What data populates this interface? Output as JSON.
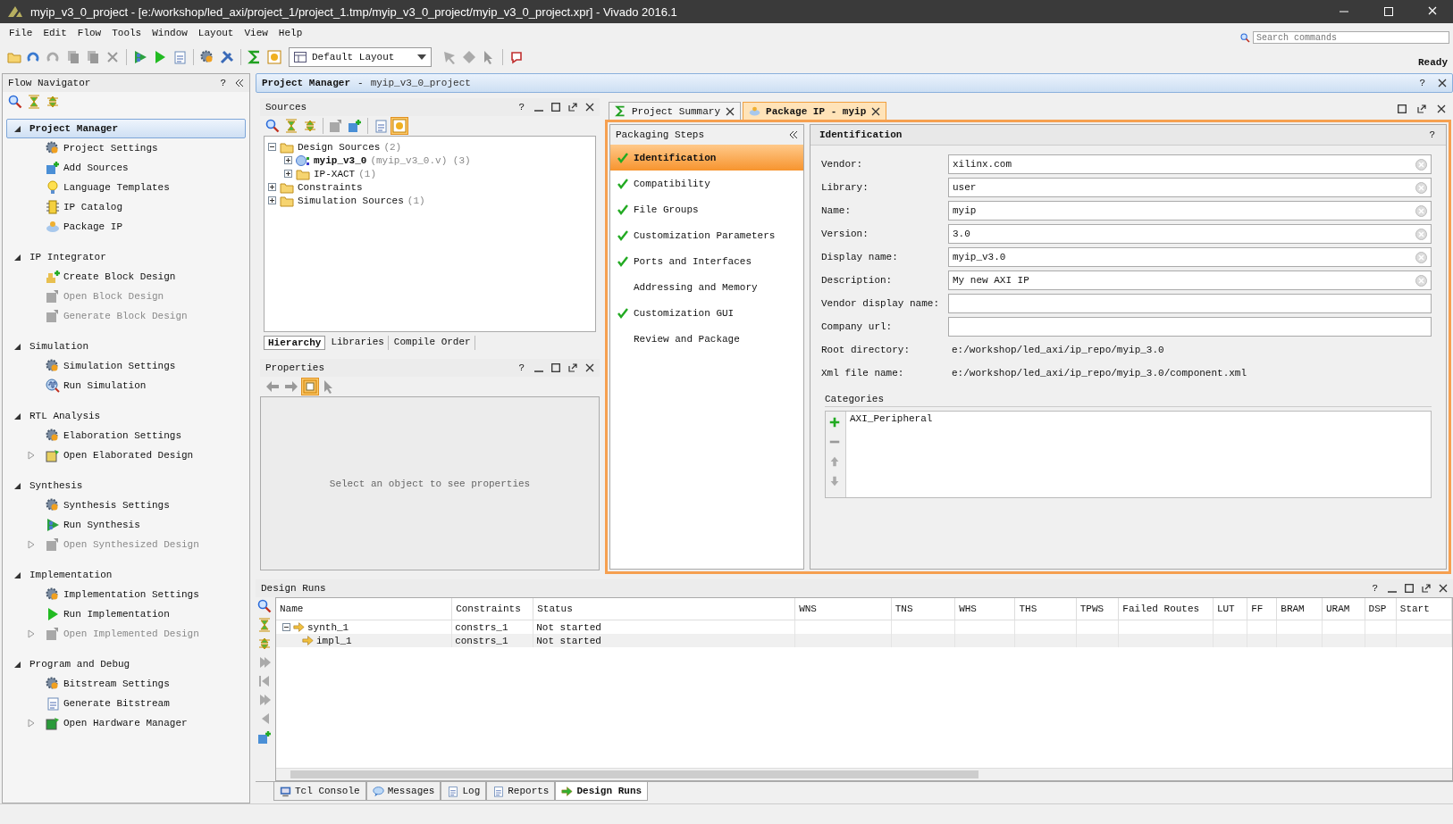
{
  "window": {
    "title": "myip_v3_0_project - [e:/workshop/led_axi/project_1/project_1.tmp/myip_v3_0_project/myip_v3_0_project.xpr] - Vivado 2016.1"
  },
  "menu": [
    "File",
    "Edit",
    "Flow",
    "Tools",
    "Window",
    "Layout",
    "View",
    "Help"
  ],
  "toolbar": {
    "layout": "Default Layout"
  },
  "search": {
    "placeholder": "Search commands"
  },
  "status": "Ready",
  "flow_navigator": {
    "title": "Flow Navigator",
    "help": "?",
    "sections": [
      {
        "label": "Project Manager",
        "selected": true,
        "items": [
          {
            "label": "Project Settings",
            "disabled": false,
            "expandable": false
          },
          {
            "label": "Add Sources",
            "disabled": false,
            "expandable": false
          },
          {
            "label": "Language Templates",
            "disabled": false,
            "expandable": false
          },
          {
            "label": "IP Catalog",
            "disabled": false,
            "expandable": false
          },
          {
            "label": "Package IP",
            "disabled": false,
            "expandable": false
          }
        ]
      },
      {
        "label": "IP Integrator",
        "selected": false,
        "items": [
          {
            "label": "Create Block Design",
            "disabled": false,
            "expandable": false
          },
          {
            "label": "Open Block Design",
            "disabled": true,
            "expandable": false
          },
          {
            "label": "Generate Block Design",
            "disabled": true,
            "expandable": false
          }
        ]
      },
      {
        "label": "Simulation",
        "selected": false,
        "items": [
          {
            "label": "Simulation Settings",
            "disabled": false,
            "expandable": false
          },
          {
            "label": "Run Simulation",
            "disabled": false,
            "expandable": false
          }
        ]
      },
      {
        "label": "RTL Analysis",
        "selected": false,
        "items": [
          {
            "label": "Elaboration Settings",
            "disabled": false,
            "expandable": false
          },
          {
            "label": "Open Elaborated Design",
            "disabled": false,
            "expandable": true
          }
        ]
      },
      {
        "label": "Synthesis",
        "selected": false,
        "items": [
          {
            "label": "Synthesis Settings",
            "disabled": false,
            "expandable": false
          },
          {
            "label": "Run Synthesis",
            "disabled": false,
            "expandable": false
          },
          {
            "label": "Open Synthesized Design",
            "disabled": true,
            "expandable": true
          }
        ]
      },
      {
        "label": "Implementation",
        "selected": false,
        "items": [
          {
            "label": "Implementation Settings",
            "disabled": false,
            "expandable": false
          },
          {
            "label": "Run Implementation",
            "disabled": false,
            "expandable": false
          },
          {
            "label": "Open Implemented Design",
            "disabled": true,
            "expandable": true
          }
        ]
      },
      {
        "label": "Program and Debug",
        "selected": false,
        "items": [
          {
            "label": "Bitstream Settings",
            "disabled": false,
            "expandable": false
          },
          {
            "label": "Generate Bitstream",
            "disabled": false,
            "expandable": false
          },
          {
            "label": "Open Hardware Manager",
            "disabled": false,
            "expandable": true
          }
        ]
      }
    ]
  },
  "project_manager": {
    "title": "Project Manager",
    "separator": "-",
    "subtitle": "myip_v3_0_project",
    "help": "?"
  },
  "sources": {
    "title": "Sources",
    "help": "?",
    "tree": [
      {
        "label": "Design Sources",
        "detail": "(2)",
        "kind": "folder",
        "expanded": true,
        "children": [
          {
            "label": "myip_v3_0",
            "detail": "(myip_v3_0.v) (3)",
            "kind": "top",
            "expanded": false
          },
          {
            "label": "IP-XACT",
            "detail": "(1)",
            "kind": "folder",
            "expanded": false
          }
        ]
      },
      {
        "label": "Constraints",
        "kind": "folder",
        "expanded": false
      },
      {
        "label": "Simulation Sources",
        "detail": "(1)",
        "kind": "folder",
        "expanded": false
      }
    ],
    "tabs": [
      {
        "label": "Hierarchy",
        "selected": true
      },
      {
        "label": "Libraries",
        "selected": false
      },
      {
        "label": "Compile Order",
        "selected": false
      }
    ]
  },
  "properties": {
    "title": "Properties",
    "help": "?",
    "message": "Select an object to see properties"
  },
  "editor_tabs": [
    {
      "label": "Project Summary",
      "selected": false
    },
    {
      "label": "Package IP - myip",
      "selected": true
    }
  ],
  "packaging_steps": {
    "title": "Packaging Steps",
    "steps": [
      {
        "label": "Identification",
        "done": true,
        "selected": true
      },
      {
        "label": "Compatibility",
        "done": true,
        "selected": false
      },
      {
        "label": "File Groups",
        "done": true,
        "selected": false
      },
      {
        "label": "Customization Parameters",
        "done": true,
        "selected": false
      },
      {
        "label": "Ports and Interfaces",
        "done": true,
        "selected": false
      },
      {
        "label": "Addressing and Memory",
        "done": false,
        "selected": false
      },
      {
        "label": "Customization GUI",
        "done": true,
        "selected": false
      },
      {
        "label": "Review and Package",
        "done": false,
        "selected": false
      }
    ]
  },
  "identification": {
    "title": "Identification",
    "help": "?",
    "fields": [
      {
        "label": "Vendor:",
        "value": "xilinx.com",
        "kind": "input"
      },
      {
        "label": "Library:",
        "value": "user",
        "kind": "input"
      },
      {
        "label": "Name:",
        "value": "myip",
        "kind": "input"
      },
      {
        "label": "Version:",
        "value": "3.0",
        "kind": "input"
      },
      {
        "label": "Display name:",
        "value": "myip_v3.0",
        "kind": "input"
      },
      {
        "label": "Description:",
        "value": "My new AXI IP",
        "kind": "input"
      },
      {
        "label": "Vendor display name:",
        "kind": "input"
      },
      {
        "label": "Company url:",
        "kind": "input"
      },
      {
        "label": "Root directory:",
        "value": "e:/workshop/led_axi/ip_repo/myip_3.0",
        "kind": "text"
      },
      {
        "label": "Xml file name:",
        "value": "e:/workshop/led_axi/ip_repo/myip_3.0/component.xml",
        "kind": "text"
      }
    ],
    "categories": {
      "title": "Categories",
      "items": [
        "AXI_Peripheral"
      ]
    }
  },
  "design_runs": {
    "title": "Design Runs",
    "help": "?",
    "columns": [
      "Name",
      "Constraints",
      "Status",
      "WNS",
      "TNS",
      "WHS",
      "THS",
      "TPWS",
      "Failed Routes",
      "LUT",
      "FF",
      "BRAM",
      "URAM",
      "DSP",
      "Start"
    ],
    "rows": [
      {
        "name": "synth_1",
        "constraints": "constrs_1",
        "status": "Not started",
        "expanded": true,
        "children": [
          {
            "name": "impl_1",
            "constraints": "constrs_1",
            "status": "Not started"
          }
        ]
      }
    ]
  },
  "bottom_tabs": [
    {
      "label": "Tcl Console",
      "selected": false
    },
    {
      "label": "Messages",
      "selected": false
    },
    {
      "label": "Log",
      "selected": false
    },
    {
      "label": "Reports",
      "selected": false
    },
    {
      "label": "Design Runs",
      "selected": true
    }
  ]
}
